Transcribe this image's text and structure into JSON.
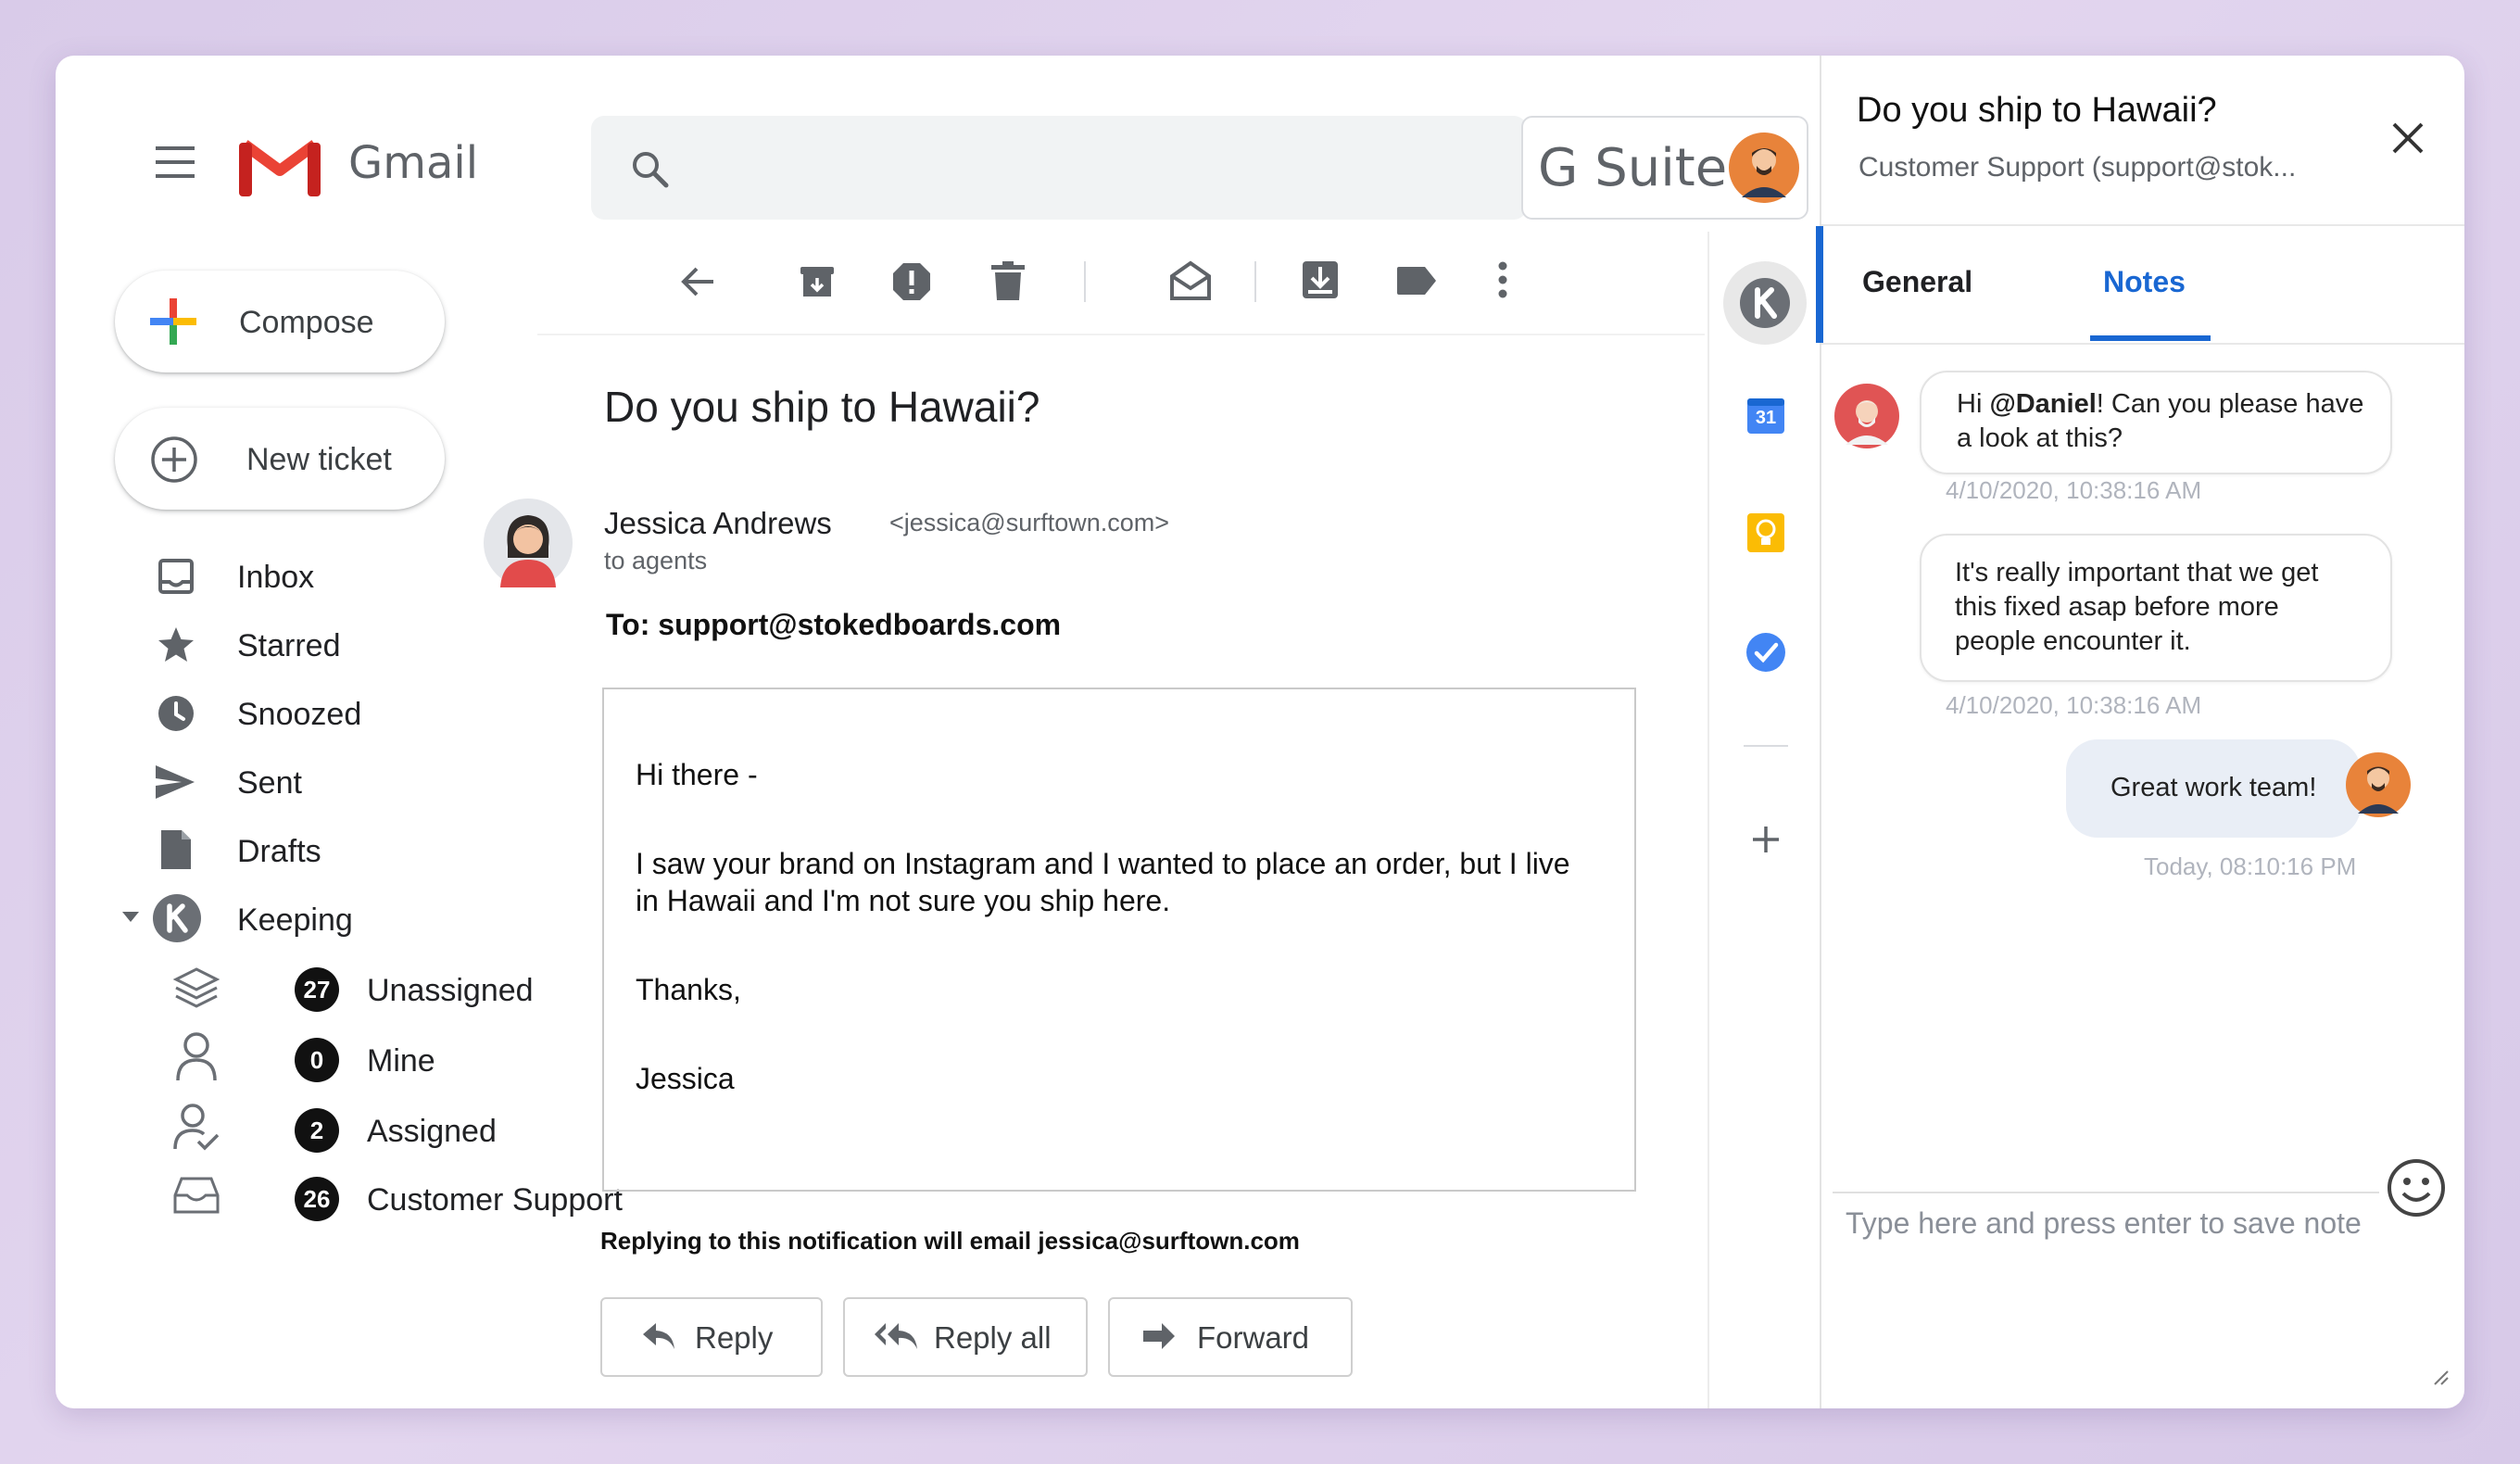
{
  "app": {
    "name": "Gmail"
  },
  "header": {
    "suite_label": "G Suite",
    "search": {
      "value": "",
      "placeholder": ""
    }
  },
  "nav": {
    "compose_label": "Compose",
    "new_ticket_label": "New ticket",
    "items": [
      {
        "label": "Inbox",
        "icon": "inbox-icon"
      },
      {
        "label": "Starred",
        "icon": "star-icon"
      },
      {
        "label": "Snoozed",
        "icon": "clock-icon"
      },
      {
        "label": "Sent",
        "icon": "send-icon"
      },
      {
        "label": "Drafts",
        "icon": "draft-icon"
      },
      {
        "label": "Keeping",
        "icon": "keeping-logo-icon"
      }
    ],
    "keeping_items": [
      {
        "label": "Unassigned",
        "count": "27",
        "icon": "layers-icon"
      },
      {
        "label": "Mine",
        "count": "0",
        "icon": "person-icon"
      },
      {
        "label": "Assigned",
        "count": "2",
        "icon": "person-check-icon"
      },
      {
        "label": "Customer Support",
        "count": "26",
        "icon": "inbox-tray-icon"
      }
    ]
  },
  "toolbar": {
    "icons": [
      "back-arrow-icon",
      "archive-icon",
      "report-spam-icon",
      "delete-icon",
      "mark-unread-icon",
      "move-to-icon",
      "label-icon",
      "more-vert-icon"
    ]
  },
  "email": {
    "subject": "Do you ship to Hawaii?",
    "sender_name": "Jessica Andrews",
    "sender_email": "<jessica@surftown.com>",
    "to_short": "to agents",
    "to_line": "To: support@stokedboards.com",
    "body": {
      "greeting": "Hi there -",
      "para_line1": "I saw your brand on Instagram and I wanted to place an order, but I live",
      "para_line2": "in Hawaii and I'm not sure you ship here.",
      "thanks": "Thanks,",
      "signature": "Jessica"
    },
    "reply_note": "Replying to this notification will email jessica@surftown.com",
    "actions": {
      "reply": "Reply",
      "reply_all": "Reply all",
      "forward": "Forward"
    }
  },
  "side_strip": {
    "calendar_day": "31",
    "icons": [
      "keeping-addon-icon",
      "calendar-icon",
      "keep-bulb-icon",
      "tasks-icon",
      "add-icon"
    ]
  },
  "panel": {
    "title": "Do you ship to Hawaii?",
    "subtitle": "Customer Support (support@stok...",
    "tabs": [
      "General",
      "Notes"
    ],
    "active_tab": "Notes",
    "notes": [
      {
        "mention": "@Daniel",
        "pre": "Hi ",
        "line1_rest": "! Can you please have",
        "line2": "a look at this?",
        "time": "4/10/2020, 10:38:16 AM"
      },
      {
        "line1": "It's really important that we get",
        "line2": "this fixed asap before more",
        "line3": "people encounter it.",
        "time": "4/10/2020, 10:38:16 AM"
      },
      {
        "text": "Great work team!",
        "time": "Today, 08:10:16 PM"
      }
    ],
    "input": {
      "value": "",
      "placeholder": "Type here and press enter to save note"
    }
  },
  "colors": {
    "gmail_red": "#ea4335",
    "accent_blue": "#1a73e8",
    "panel_blue": "#1967d2",
    "bubble_self": "#e9eef6",
    "avatar_orange": "#e8833a"
  }
}
